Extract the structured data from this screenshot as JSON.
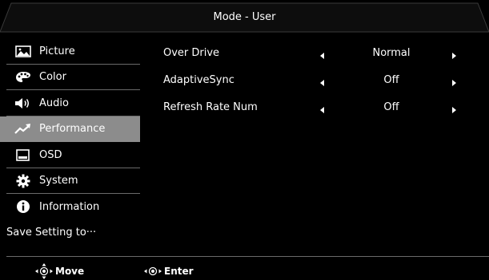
{
  "header": {
    "title": "Mode - User"
  },
  "sidebar": {
    "items": [
      {
        "label": "Picture",
        "icon": "picture-icon"
      },
      {
        "label": "Color",
        "icon": "palette-icon"
      },
      {
        "label": "Audio",
        "icon": "speaker-icon"
      },
      {
        "label": "Performance",
        "icon": "trend-icon",
        "selected": true
      },
      {
        "label": "OSD",
        "icon": "osd-window-icon"
      },
      {
        "label": "System",
        "icon": "gear-icon"
      },
      {
        "label": "Information",
        "icon": "info-icon"
      }
    ],
    "save_label": "Save Setting to···"
  },
  "settings": [
    {
      "name": "Over Drive",
      "value": "Normal"
    },
    {
      "name": "AdaptiveSync",
      "value": "Off"
    },
    {
      "name": "Refresh Rate Num",
      "value": "Off"
    }
  ],
  "footer": {
    "move_label": "Move",
    "enter_label": "Enter"
  },
  "colors": {
    "selected_bg": "#8c8c8c",
    "divider": "#6a6a6a",
    "title_bar": "#0d0d0d"
  }
}
